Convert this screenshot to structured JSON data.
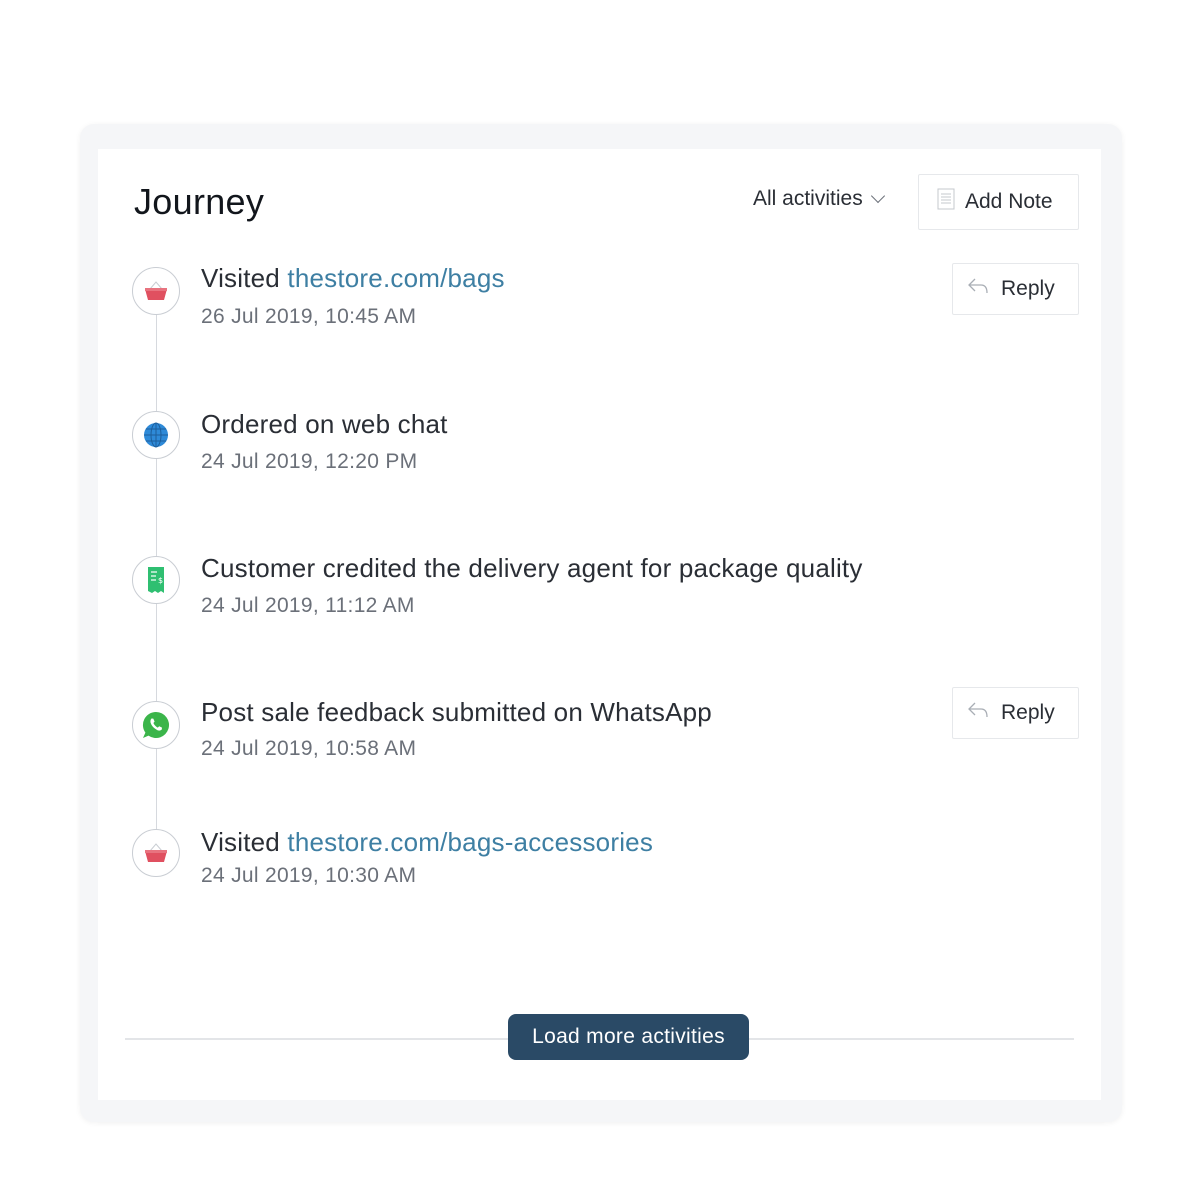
{
  "header": {
    "title": "Journey",
    "filter_label": "All activities",
    "add_note_label": "Add Note"
  },
  "activities": [
    {
      "prefix": "Visited ",
      "link": "thestore.com/bags",
      "date": "26 Jul 2019, 10:45 AM",
      "icon": "basket-icon",
      "reply_label": "Reply"
    },
    {
      "text": "Ordered on web chat",
      "date": "24 Jul 2019, 12:20 PM",
      "icon": "globe-icon"
    },
    {
      "text": "Customer credited the delivery agent for package quality",
      "date": "24 Jul 2019, 11:12 AM",
      "icon": "receipt-icon"
    },
    {
      "text": "Post sale feedback submitted on WhatsApp",
      "date": "24 Jul 2019, 10:58 AM",
      "icon": "whatsapp-icon",
      "reply_label": "Reply"
    },
    {
      "prefix": "Visited ",
      "link": "thestore.com/bags-accessories",
      "date": "24 Jul 2019, 10:30 AM",
      "icon": "basket-icon"
    }
  ],
  "footer": {
    "load_more_label": "Load more activities"
  },
  "colors": {
    "link": "#3e7fa3",
    "button_dark": "#2a4a66",
    "basket": "#e05060",
    "globe": "#2e8ad8",
    "receipt": "#2fbf71",
    "whatsapp": "#3bb54a"
  }
}
